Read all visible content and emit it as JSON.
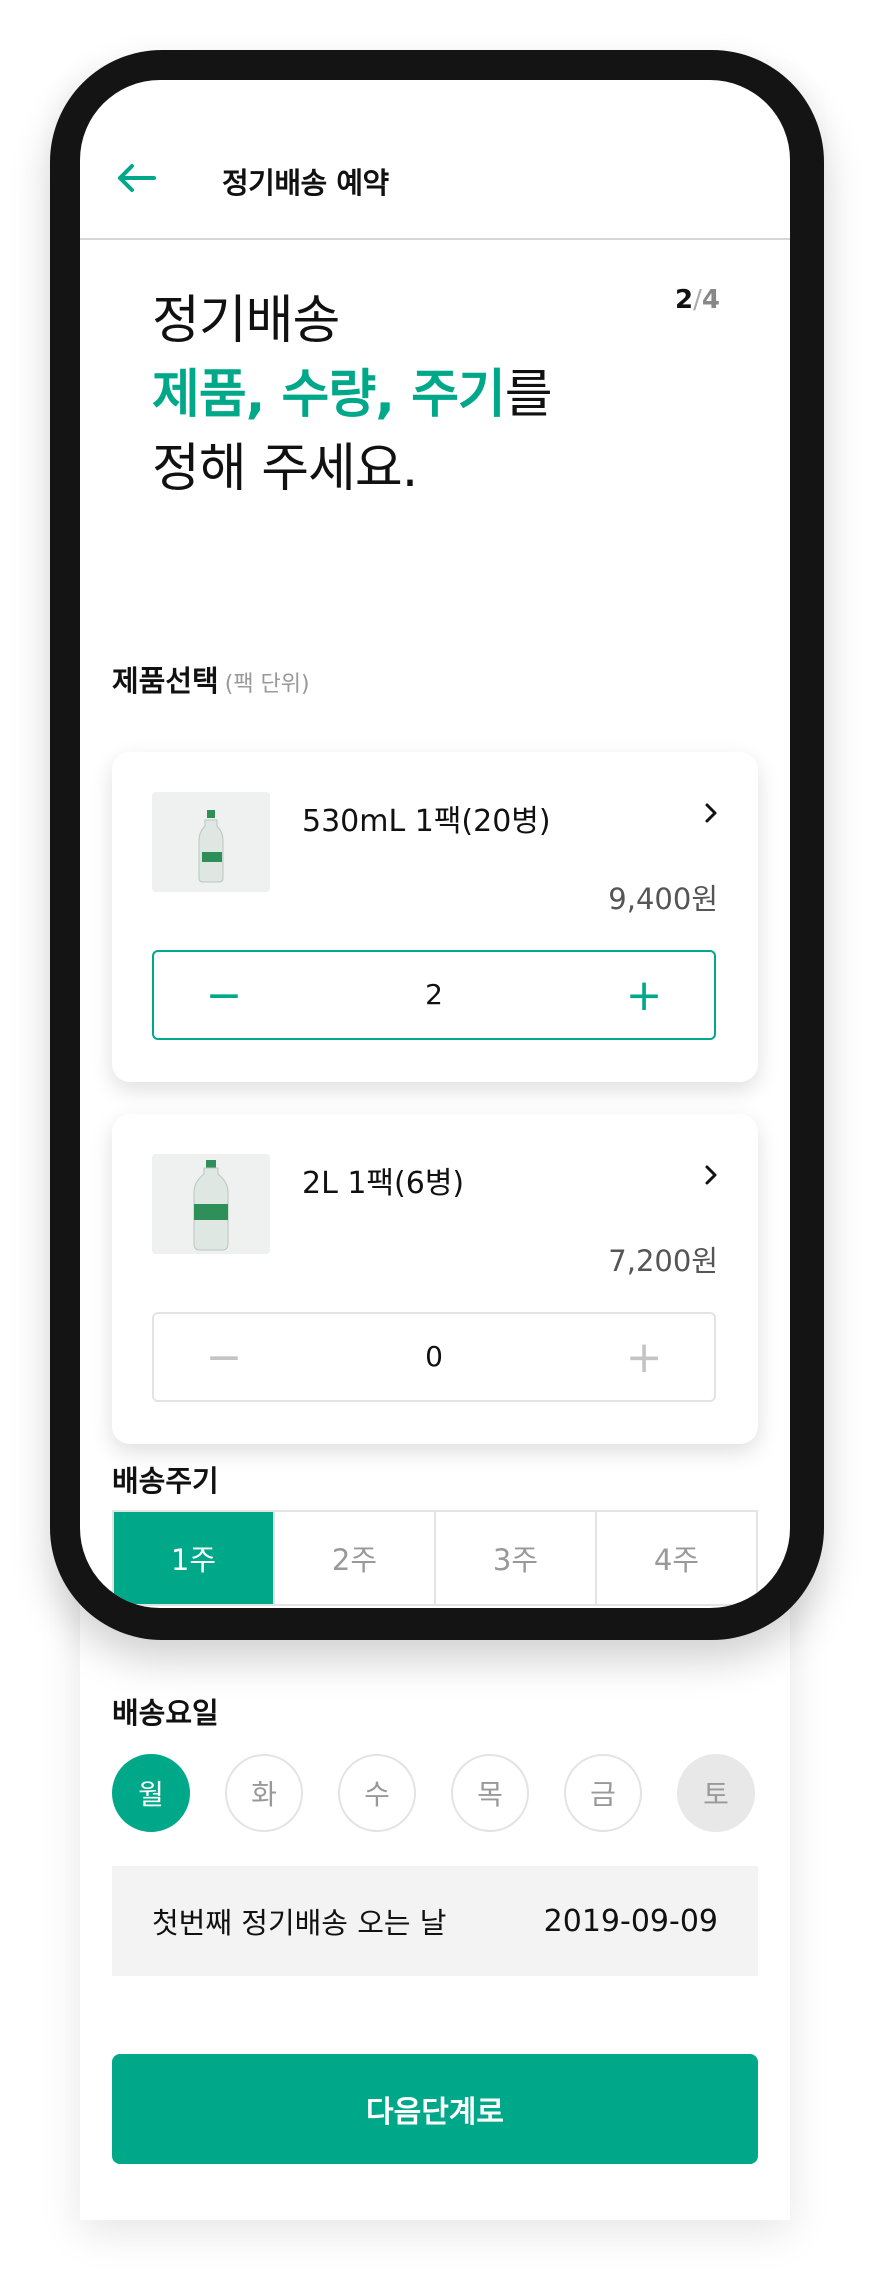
{
  "header": {
    "title": "정기배송 예약",
    "back_icon": "arrow-left-icon"
  },
  "hero": {
    "line1": "정기배송",
    "accent": "제품, 수량, 주기",
    "particle": "를",
    "line3": "정해 주세요."
  },
  "step": {
    "current": "2",
    "separator": "/",
    "total": "4"
  },
  "products_section": {
    "label": "제품선택",
    "sub": "(팩 단위)"
  },
  "products": [
    {
      "name": "530mL 1팩(20병)",
      "price": "9,400원",
      "quantity": "2",
      "minus": "−",
      "plus": "+"
    },
    {
      "name": "2L 1팩(6병)",
      "price": "7,200원",
      "quantity": "0",
      "minus": "−",
      "plus": "+"
    }
  ],
  "cycle_section": {
    "label": "배송주기",
    "tabs": [
      "1주",
      "2주",
      "3주",
      "4주"
    ],
    "selected": "1주"
  },
  "day_section": {
    "label": "배송요일",
    "days": [
      "월",
      "화",
      "수",
      "목",
      "금",
      "토"
    ],
    "selected": "월",
    "disabled": "토"
  },
  "first_delivery": {
    "label": "첫번째 정기배송 오는 날",
    "date": "2019-09-09"
  },
  "next_button": {
    "label": "다음단계로"
  },
  "colors": {
    "accent": "#00a88a",
    "frame": "#141414",
    "muted": "#999999"
  }
}
